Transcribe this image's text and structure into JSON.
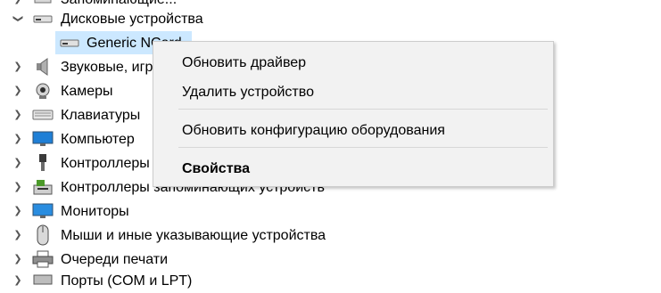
{
  "tree": {
    "items": [
      {
        "label": "Запоминающие...",
        "partial": true
      },
      {
        "label": "Дисковые устройства",
        "expanded": true
      },
      {
        "label": "Generic NCard",
        "selected": true
      },
      {
        "label": "Звуковые, игровые и видеоустройства"
      },
      {
        "label": "Камеры"
      },
      {
        "label": "Клавиатуры"
      },
      {
        "label": "Компьютер"
      },
      {
        "label": "Контроллеры USB"
      },
      {
        "label": "Контроллеры запоминающих устройств"
      },
      {
        "label": "Мониторы"
      },
      {
        "label": "Мыши и иные указывающие устройства"
      },
      {
        "label": "Очереди печати"
      },
      {
        "label": "Порты (COM и LPT)",
        "partial": true
      }
    ]
  },
  "context_menu": {
    "update_driver": "Обновить драйвер",
    "uninstall_device": "Удалить устройство",
    "scan_hardware": "Обновить конфигурацию оборудования",
    "properties": "Свойства"
  },
  "colors": {
    "selection": "#cce8ff",
    "menu_bg": "#f2f2f2",
    "separator": "#d7d7d7"
  }
}
